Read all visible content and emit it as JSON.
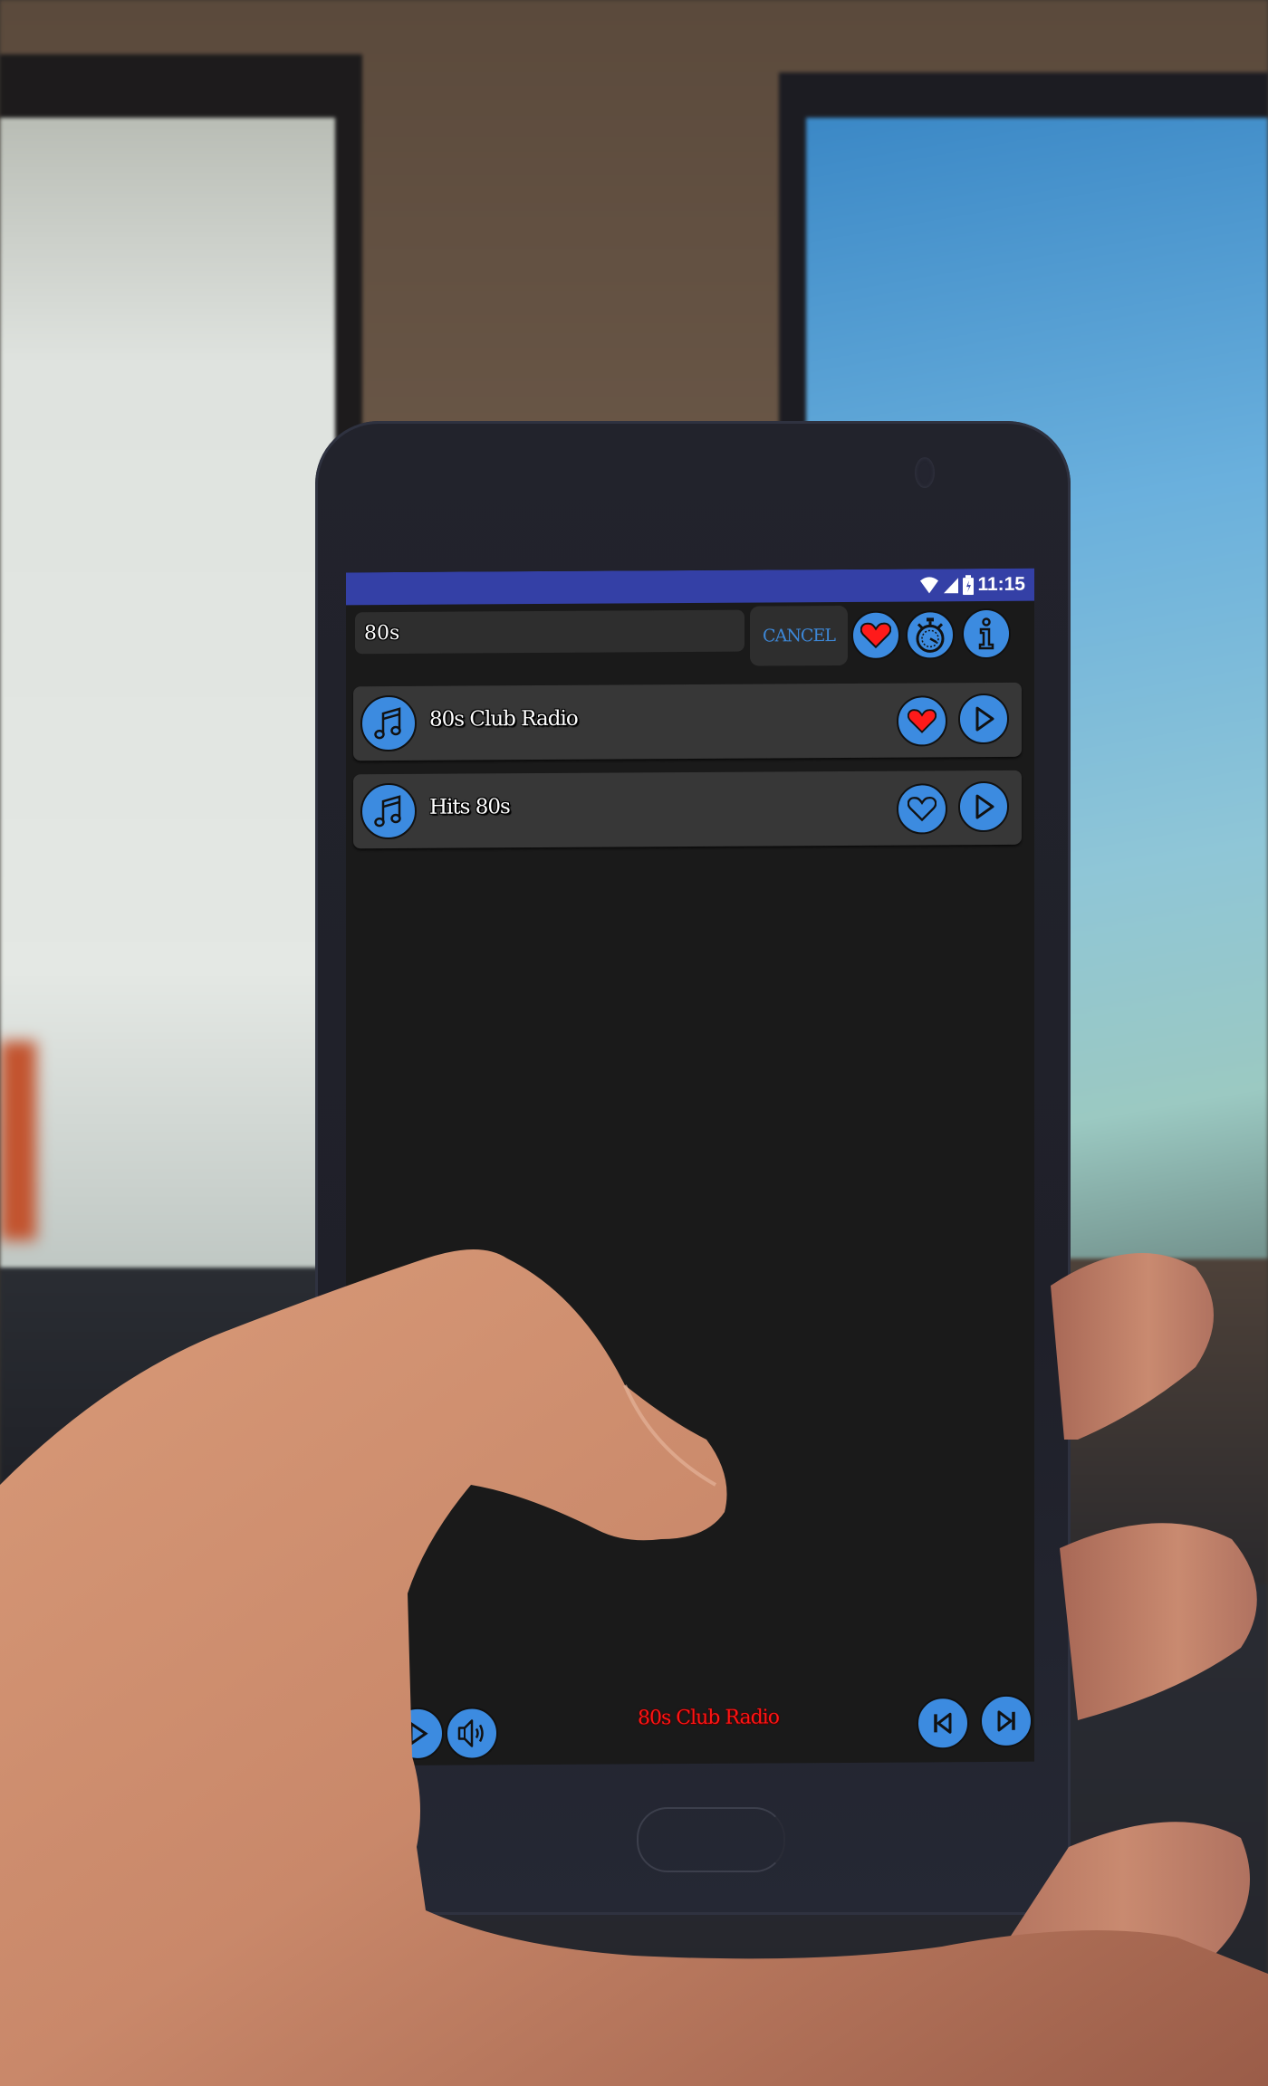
{
  "status_bar": {
    "time": "11:15",
    "icons": [
      "wifi-icon",
      "signal-icon",
      "battery-icon"
    ]
  },
  "search": {
    "value": "80s",
    "placeholder": ""
  },
  "toolbar": {
    "cancel_label": "CANCEL",
    "buttons": [
      "favorites-heart-icon",
      "sleep-timer-stopwatch-icon",
      "info-icon"
    ]
  },
  "stations": [
    {
      "name": "80s Club Radio",
      "favorite": true
    },
    {
      "name": "Hits 80s",
      "favorite": false
    }
  ],
  "player": {
    "now_playing": "80s Club Radio",
    "controls": [
      "play-pause-icon",
      "volume-icon",
      "previous-icon",
      "next-icon"
    ]
  },
  "colors": {
    "status_bar": "#3440a6",
    "accent_blue": "#3c8be0",
    "favorite_red": "#ff1414",
    "screen_bg": "#1a1a1a",
    "row_bg": "#373737"
  }
}
